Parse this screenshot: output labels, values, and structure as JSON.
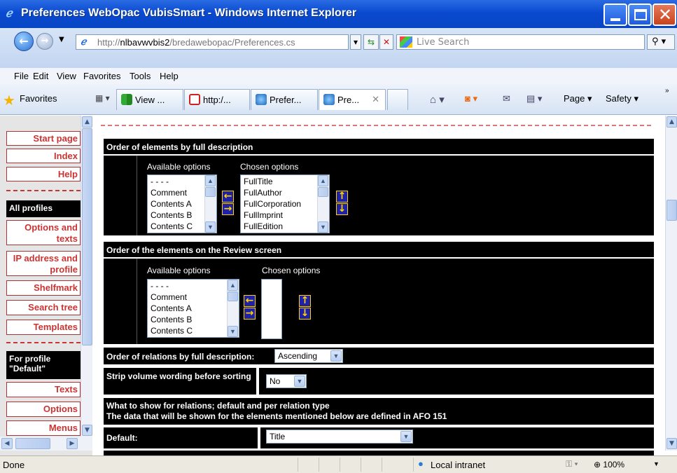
{
  "window": {
    "title": "Preferences WebOpac VubisSmart - Windows Internet Explorer"
  },
  "address": {
    "url_prefix": "http://",
    "url_host": "nlbavwvbis2",
    "url_path": "/bredawebopac/Preferences.cs",
    "search_placeholder": "Live Search"
  },
  "menu": {
    "items": [
      "File",
      "Edit",
      "View",
      "Favorites",
      "Tools",
      "Help"
    ]
  },
  "favbar": {
    "favorites_label": "Favorites",
    "tabs": [
      {
        "label": "View ..."
      },
      {
        "label": "http:/..."
      },
      {
        "label": "Prefer..."
      },
      {
        "label": "Pre..."
      }
    ],
    "page_label": "Page",
    "safety_label": "Safety"
  },
  "leftnav": {
    "items_top": [
      "Start page",
      "Index",
      "Help"
    ],
    "all_profiles_header": "All profiles",
    "profile_items": [
      "Options and texts",
      "IP address and profile",
      "Shelfmark",
      "Search tree",
      "Templates"
    ],
    "for_profile_header": "For profile \"Default\"",
    "default_items": [
      "Texts",
      "Options",
      "Menus"
    ]
  },
  "content": {
    "section1": {
      "title": "Order of elements by full description",
      "available_label": "Available options",
      "chosen_label": "Chosen options",
      "available": [
        "- - - -",
        "Comment",
        "Contents A",
        "Contents B",
        "Contents C"
      ],
      "chosen": [
        "FullTitle",
        "FullAuthor",
        "FullCorporation",
        "FullImprint",
        "FullEdition"
      ]
    },
    "section2": {
      "title": "Order of the elements on the Review screen",
      "available_label": "Available options",
      "chosen_label": "Chosen options",
      "available": [
        "- - - -",
        "Comment",
        "Contents A",
        "Contents B",
        "Contents C"
      ]
    },
    "relations": {
      "label": "Order of relations by full description:",
      "value": "Ascending"
    },
    "strip": {
      "label": "Strip volume wording before sorting",
      "value": "No"
    },
    "show": {
      "line1": "What to show for relations; default and per relation type",
      "line2": "The data that will be shown for the elements mentioned below are defined in AFO 151"
    },
    "default": {
      "label": "Default:",
      "value": "Title"
    }
  },
  "status": {
    "text": "Done",
    "zone": "Local intranet",
    "zoom": "100%"
  }
}
